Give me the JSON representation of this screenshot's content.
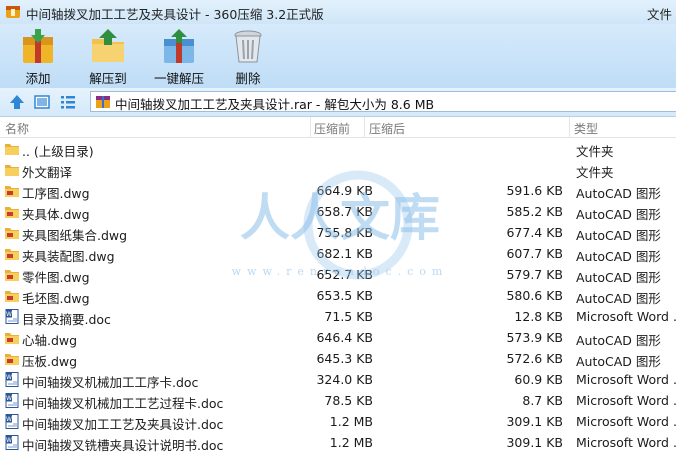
{
  "window": {
    "title": "中间轴拨叉加工工艺及夹具设计 - 360压缩 3.2正式版",
    "menu_label": "文件"
  },
  "toolbar": {
    "buttons": [
      {
        "id": "add",
        "label": "添加",
        "icon": "add-archive-icon"
      },
      {
        "id": "extract-to",
        "label": "解压到",
        "icon": "extract-to-folder-icon"
      },
      {
        "id": "one-click",
        "label": "一键解压",
        "icon": "one-click-extract-icon"
      },
      {
        "id": "delete",
        "label": "删除",
        "icon": "trash-can-icon"
      }
    ]
  },
  "address": {
    "path": "中间轴拨叉加工工艺及夹具设计.rar - 解包大小为 8.6 MB"
  },
  "columns": {
    "name": "名称",
    "size": "压缩前",
    "packed": "压缩后",
    "type": "类型"
  },
  "files": [
    {
      "icon": "folder",
      "name": ".. (上级目录)",
      "size": "",
      "packed": "",
      "type": "文件夹"
    },
    {
      "icon": "folder",
      "name": "外文翻译",
      "size": "",
      "packed": "",
      "type": "文件夹"
    },
    {
      "icon": "dwg",
      "name": "工序图.dwg",
      "size": "664.9 KB",
      "packed": "591.6 KB",
      "type": "AutoCAD 图形"
    },
    {
      "icon": "dwg",
      "name": "夹具体.dwg",
      "size": "658.7 KB",
      "packed": "585.2 KB",
      "type": "AutoCAD 图形"
    },
    {
      "icon": "dwg",
      "name": "夹具图纸集合.dwg",
      "size": "755.8 KB",
      "packed": "677.4 KB",
      "type": "AutoCAD 图形"
    },
    {
      "icon": "dwg",
      "name": "夹具装配图.dwg",
      "size": "682.1 KB",
      "packed": "607.7 KB",
      "type": "AutoCAD 图形"
    },
    {
      "icon": "dwg",
      "name": "零件图.dwg",
      "size": "652.7 KB",
      "packed": "579.7 KB",
      "type": "AutoCAD 图形"
    },
    {
      "icon": "dwg",
      "name": "毛坯图.dwg",
      "size": "653.5 KB",
      "packed": "580.6 KB",
      "type": "AutoCAD 图形"
    },
    {
      "icon": "doc",
      "name": "目录及摘要.doc",
      "size": "71.5 KB",
      "packed": "12.8 KB",
      "type": "Microsoft Word ."
    },
    {
      "icon": "dwg",
      "name": "心轴.dwg",
      "size": "646.4 KB",
      "packed": "573.9 KB",
      "type": "AutoCAD 图形"
    },
    {
      "icon": "dwg",
      "name": "压板.dwg",
      "size": "645.3 KB",
      "packed": "572.6 KB",
      "type": "AutoCAD 图形"
    },
    {
      "icon": "doc",
      "name": "中间轴拨叉机械加工工序卡.doc",
      "size": "324.0 KB",
      "packed": "60.9 KB",
      "type": "Microsoft Word ."
    },
    {
      "icon": "doc",
      "name": "中间轴拨叉机械加工工艺过程卡.doc",
      "size": "78.5 KB",
      "packed": "8.7 KB",
      "type": "Microsoft Word ."
    },
    {
      "icon": "doc",
      "name": "中间轴拨叉加工工艺及夹具设计.doc",
      "size": "1.2 MB",
      "packed": "309.1 KB",
      "type": "Microsoft Word ."
    },
    {
      "icon": "doc",
      "name": "中间轴拨叉铣槽夹具设计说明书.doc",
      "size": "1.2 MB",
      "packed": "309.1 KB",
      "type": "Microsoft Word ."
    }
  ],
  "watermark": {
    "text": "人人文库",
    "url_text": "www.renrendoc.com"
  },
  "colors": {
    "titlebar": "#d6eafb",
    "toolbar": "#c6e0f7",
    "folder": "#f2c14e",
    "word": "#2b5797",
    "watermark": "#8ec1ea"
  }
}
